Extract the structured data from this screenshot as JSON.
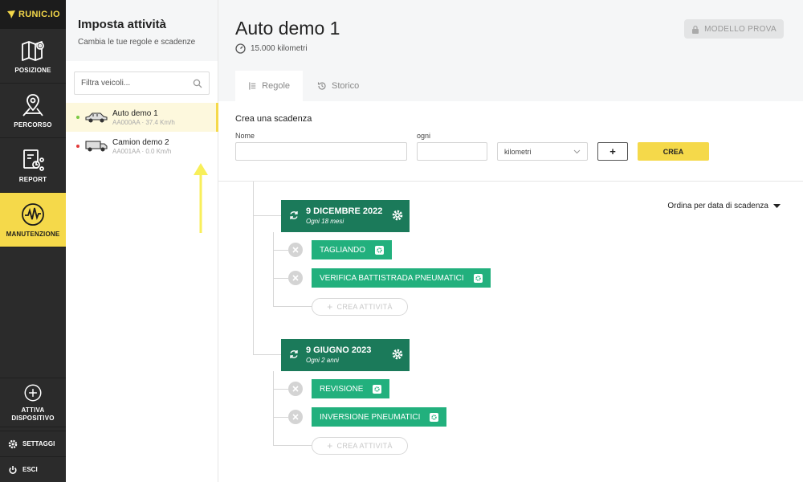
{
  "brand": {
    "name": "RUNIC.IO"
  },
  "colors": {
    "accent": "#f5d94a",
    "nav_bg": "#2b2b2b",
    "deadline_bg": "#1b7a5a",
    "task_bg": "#22b07d"
  },
  "nav": {
    "items": [
      {
        "label": "POSIZIONE",
        "icon": "map-icon"
      },
      {
        "label": "PERCORSO",
        "icon": "route-icon"
      },
      {
        "label": "REPORT",
        "icon": "report-icon"
      },
      {
        "label": "MANUTENZIONE",
        "icon": "maintenance-icon",
        "active": true
      }
    ],
    "activate": {
      "line1": "ATTIVA",
      "line2": "DISPOSITIVO"
    },
    "settings": "SETTAGGI",
    "logout": "ESCI"
  },
  "panel": {
    "title": "Imposta attività",
    "subtitle": "Cambia le tue regole e scadenze",
    "filter_placeholder": "Filtra veicoli...",
    "vehicles": [
      {
        "name": "Auto demo 1",
        "meta": "AA000AA · 37.4 Km/h",
        "status_color": "#7ac943",
        "icon": "car-icon",
        "selected": true
      },
      {
        "name": "Camion demo 2",
        "meta": "AA001AA · 0.0 Km/h",
        "status_color": "#e23b3b",
        "icon": "truck-icon",
        "selected": false
      }
    ]
  },
  "main": {
    "title": "Auto demo 1",
    "odometer": "15.000 kilometri",
    "model_button": "MODELLO PROVA",
    "tabs": [
      {
        "label": "Regole",
        "icon": "rules-icon",
        "active": true
      },
      {
        "label": "Storico",
        "icon": "history-icon",
        "active": false
      }
    ],
    "create": {
      "title": "Crea una scadenza",
      "name_label": "Nome",
      "name_value": "",
      "every_label": "ogni",
      "every_value": "",
      "unit": "kilometri",
      "plus": "+",
      "submit": "CREA"
    },
    "sort_label": "Ordina per data di scadenza",
    "deadlines": [
      {
        "date": "9 DICEMBRE 2022",
        "every": "Ogni 18 mesi",
        "tasks": [
          "TAGLIANDO",
          "VERIFICA BATTISTRADA PNEUMATICI"
        ],
        "add_label": "CREA ATTIVITÀ"
      },
      {
        "date": "9 GIUGNO 2023",
        "every": "Ogni 2 anni",
        "tasks": [
          "REVISIONE",
          "INVERSIONE PNEUMATICI"
        ],
        "add_label": "CREA ATTIVITÀ"
      }
    ]
  }
}
